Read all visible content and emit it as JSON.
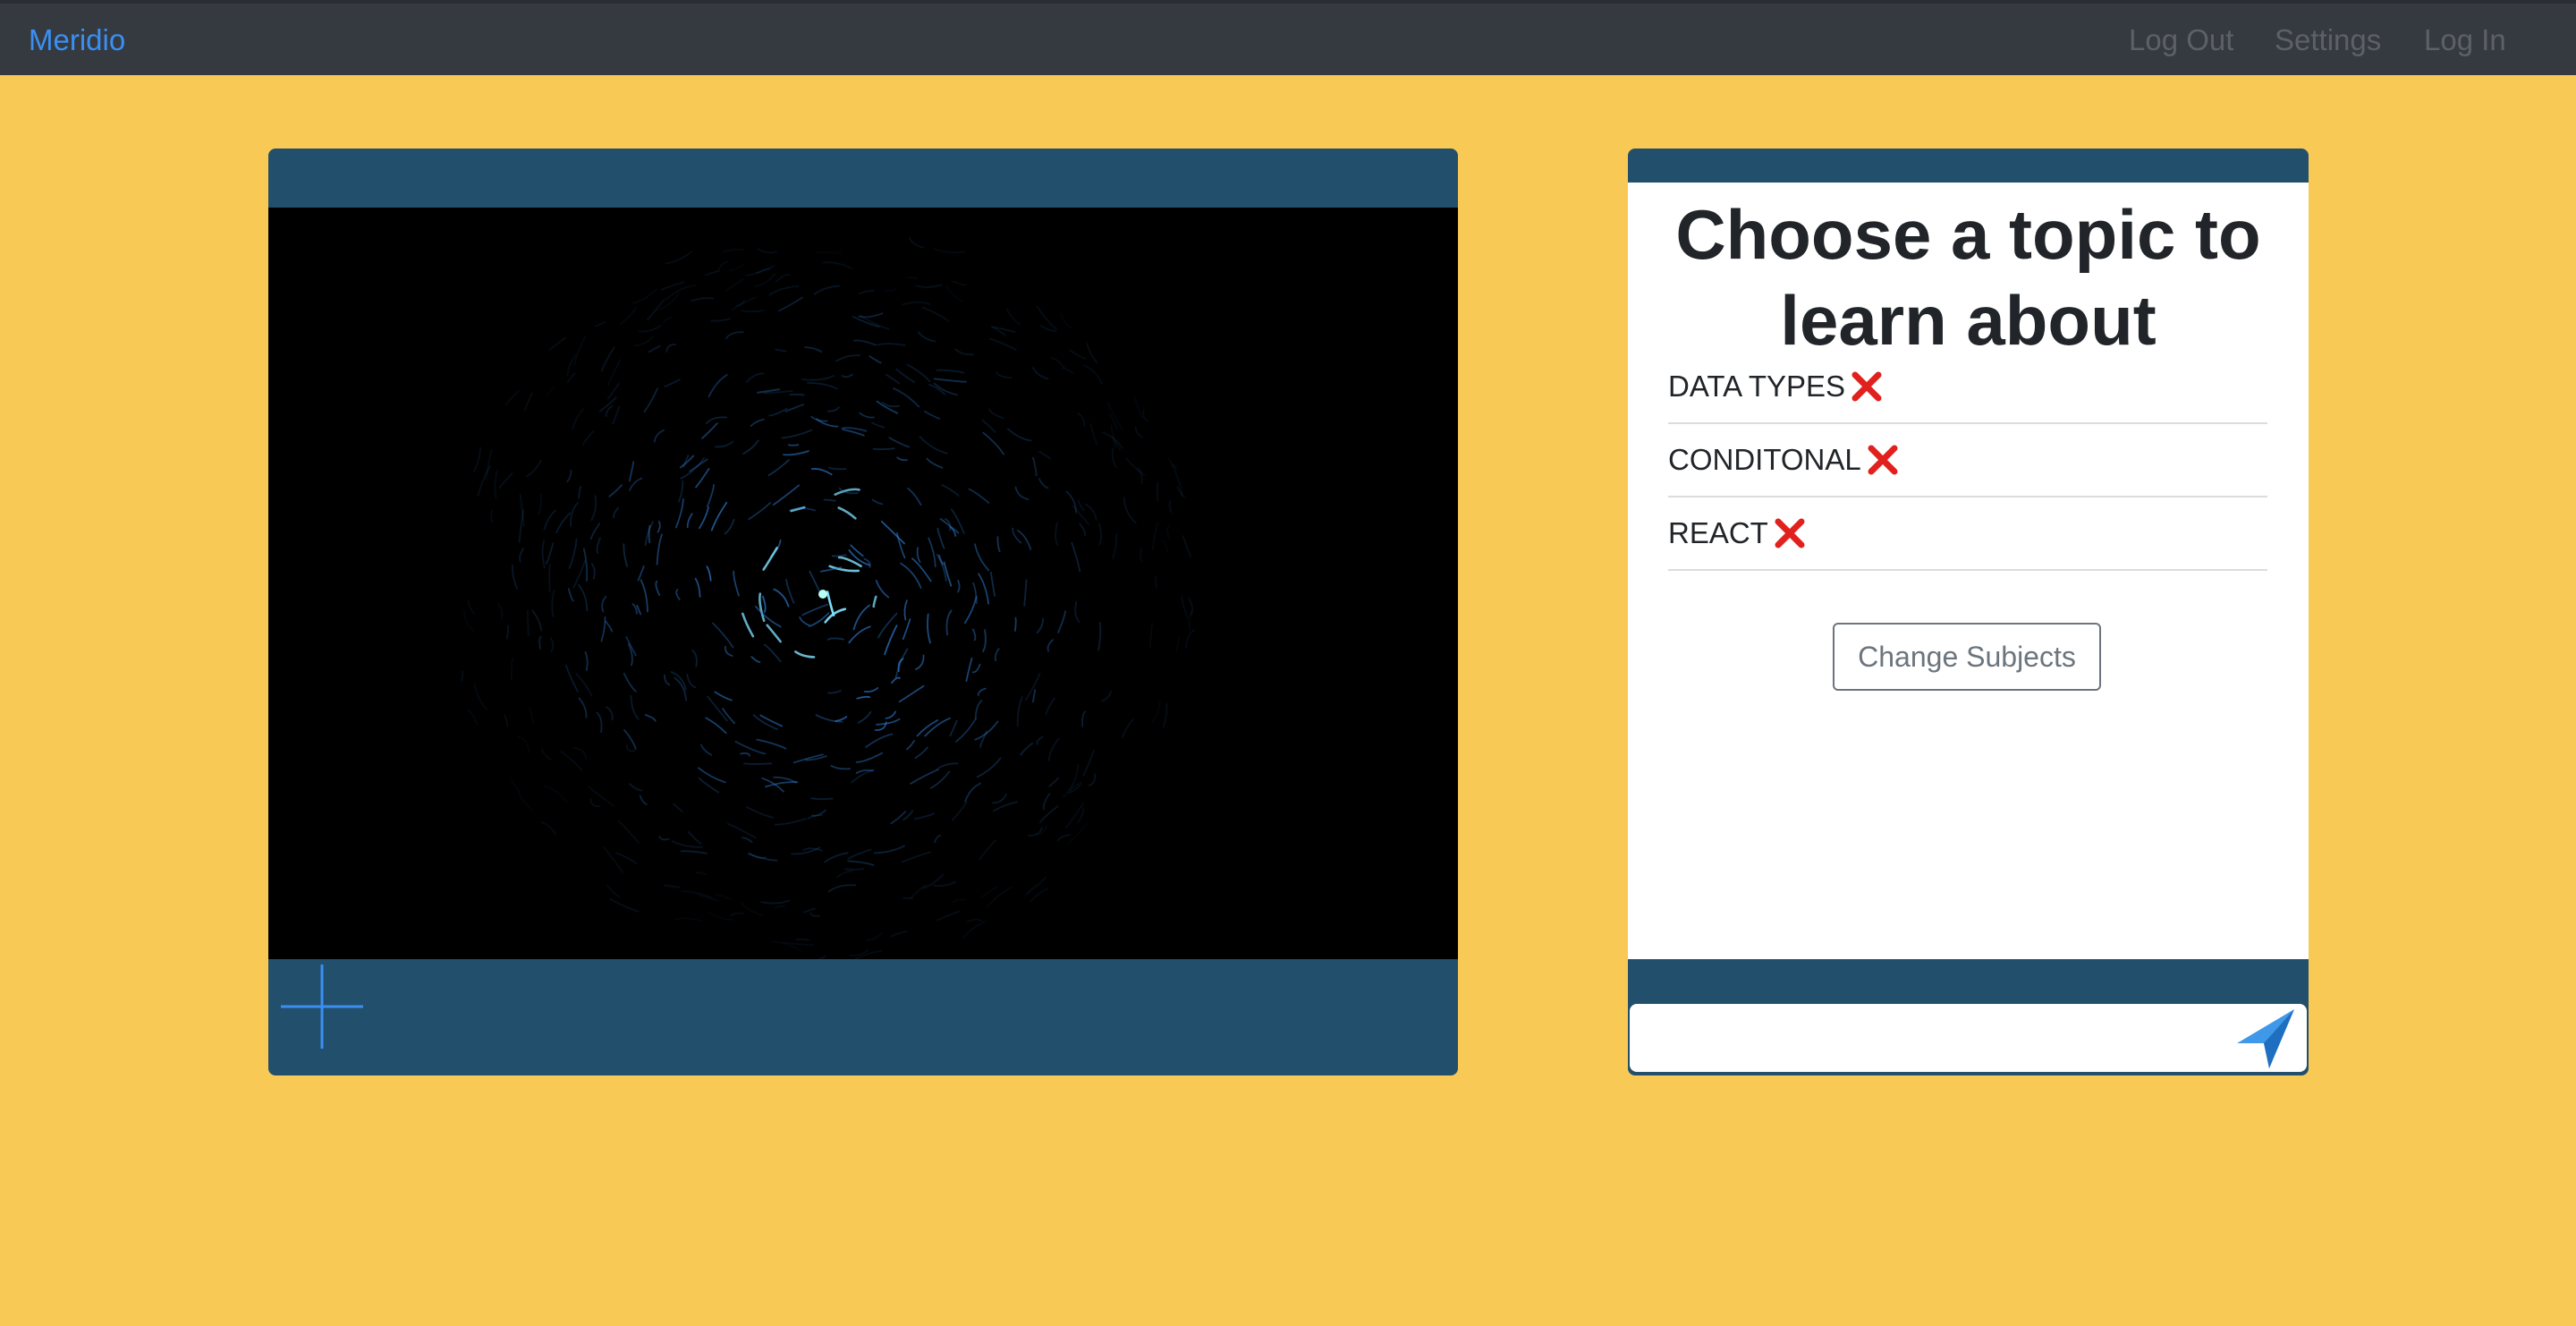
{
  "navbar": {
    "brand": "Meridio",
    "links": [
      "Log Out",
      "Settings",
      "Log In"
    ],
    "background_color": "#343a40",
    "brand_color": "#3b8ff3"
  },
  "video_panel": {
    "add_icon": "plus-icon",
    "panel_color": "#224f6b"
  },
  "topic_panel": {
    "title": "Choose a topic to learn about",
    "topics": [
      {
        "label": "DATA TYPES",
        "remove_icon": "x-icon"
      },
      {
        "label": "CONDITONAL",
        "remove_icon": "x-icon"
      },
      {
        "label": "REACT",
        "remove_icon": "x-icon"
      }
    ],
    "change_button": "Change Subjects",
    "message_placeholder": "",
    "send_icon": "paper-plane-icon"
  },
  "page_background": "#f8ca55"
}
